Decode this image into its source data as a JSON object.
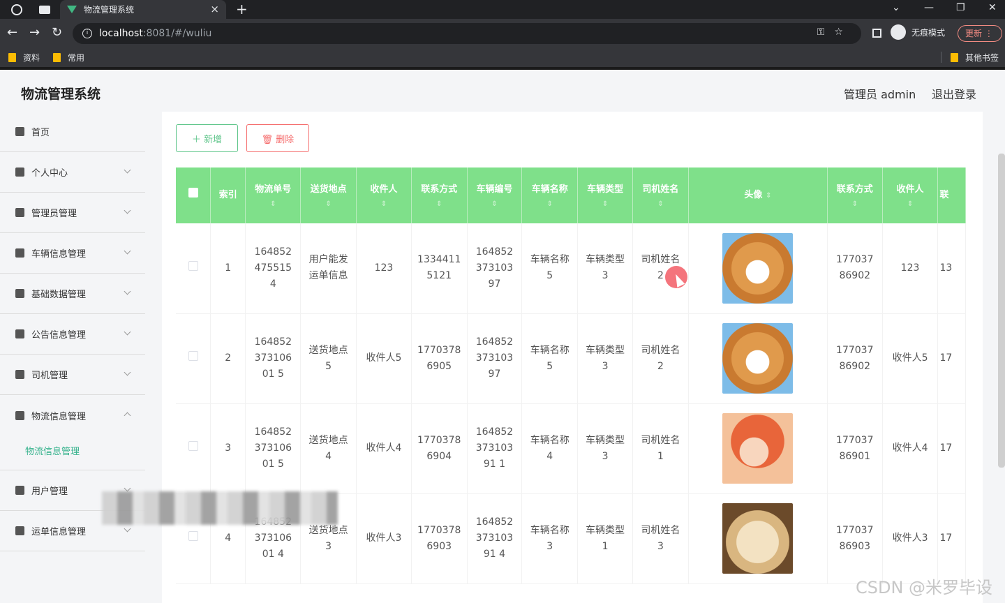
{
  "browser": {
    "tab_title": "物流管理系统",
    "tab_close": "×",
    "new_tab": "+",
    "url_host": "localhost",
    "url_path": ":8081/#/wuliu",
    "incognito_label": "无痕模式",
    "update_label": "更新",
    "bookmarks": [
      "资料",
      "常用",
      "其他书签"
    ]
  },
  "header": {
    "title": "物流管理系统",
    "admin_label": "管理员 admin",
    "logout_label": "退出登录"
  },
  "sidebar": {
    "items": [
      {
        "label": "首页",
        "icon": "home-icon"
      },
      {
        "label": "个人中心",
        "icon": "user-icon"
      },
      {
        "label": "管理员管理",
        "icon": "briefcase-icon"
      },
      {
        "label": "车辆信息管理",
        "icon": "chat-icon"
      },
      {
        "label": "基础数据管理",
        "icon": "flag-icon"
      },
      {
        "label": "公告信息管理",
        "icon": "bulb-icon"
      },
      {
        "label": "司机管理",
        "icon": "send-icon"
      },
      {
        "label": "物流信息管理",
        "icon": "monitor-icon"
      },
      {
        "label": "用户管理",
        "icon": "picture-icon"
      },
      {
        "label": "运单信息管理",
        "icon": "video-icon"
      }
    ],
    "sub_item": "物流信息管理"
  },
  "toolbar": {
    "add_label": "＋ 新增",
    "delete_label": "🗑 删除"
  },
  "table": {
    "columns": [
      "索引",
      "物流单号",
      "送货地点",
      "收件人",
      "联系方式",
      "车辆编号",
      "车辆名称",
      "车辆类型",
      "司机姓名",
      "头像",
      "联系方式",
      "收件人",
      "联"
    ],
    "rows": [
      [
        "1",
        "1648524755154",
        "用户能发运单信息",
        "123",
        "13344115121",
        "16485237310397",
        "车辆名称5",
        "车辆类型3",
        "司机姓名2",
        "dog",
        "17703786902",
        "123",
        "13"
      ],
      [
        "2",
        "16485237310601 5",
        "送货地点5",
        "收件人5",
        "17703786905",
        "16485237310397",
        "车辆名称5",
        "车辆类型3",
        "司机姓名2",
        "dog",
        "17703786902",
        "收件人5",
        "17"
      ],
      [
        "3",
        "16485237310601 5",
        "送货地点4",
        "收件人4",
        "17703786904",
        "16485237310391 1",
        "车辆名称4",
        "车辆类型3",
        "司机姓名1",
        "girl",
        "17703786901",
        "收件人4",
        "17"
      ],
      [
        "4",
        "16485237310601 4",
        "送货地点3",
        "收件人3",
        "17703786903",
        "16485237310391 4",
        "车辆名称3",
        "车辆类型1",
        "司机姓名3",
        "puppy",
        "17703786903",
        "收件人3",
        "17"
      ]
    ]
  },
  "watermark": "CSDN @米罗毕设"
}
